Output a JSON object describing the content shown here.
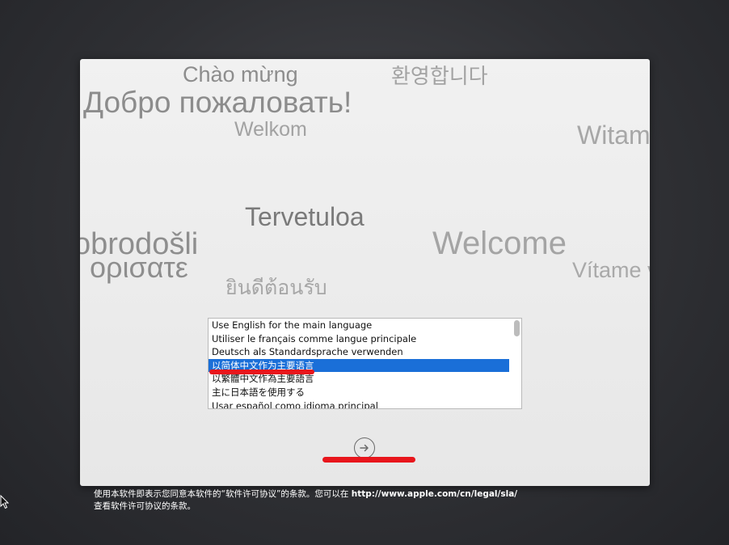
{
  "greetings": {
    "vietnamese": "Chào mừng",
    "korean": "환영합니다",
    "russian": "Добро пожаловать!",
    "dutch": "Welkom",
    "polish": "Witam",
    "finnish": "Tervetuloa",
    "croatian": "obrodošli",
    "english": "Welcome",
    "greek": ": ορισατε",
    "slovak": "Vítame v",
    "thai": "ยินดีต้อนรับ"
  },
  "language_list": {
    "items": [
      "Use English for the main language",
      "Utiliser le français comme langue principale",
      "Deutsch als Standardsprache verwenden",
      "以简体中文作为主要语言",
      "以繁體中文作為主要語言",
      "主に日本語を使用する",
      "Usar español como idioma principal"
    ],
    "selected_index": 3
  },
  "next_button": {
    "icon": "arrow-right-circle-icon"
  },
  "annotations": {
    "color": "#e8161c"
  },
  "footer": {
    "line1_prefix": "使用本软件即表示您同意本软件的“软件许可协议”的条款。您可以在 ",
    "line1_link": "http://www.apple.com/cn/legal/sla/",
    "line2": "查看软件许可协议的条款。"
  },
  "colors": {
    "selection": "#1a6fd8",
    "background": "#2f3034"
  }
}
